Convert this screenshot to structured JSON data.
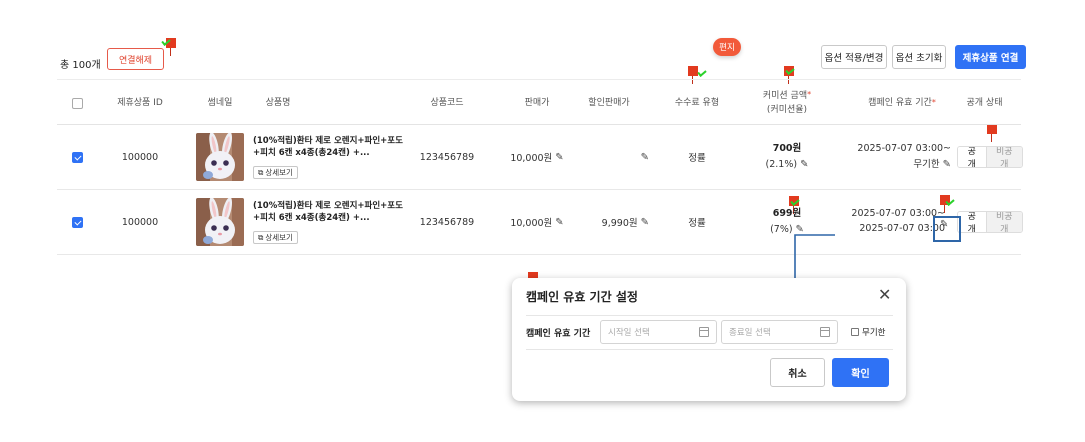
{
  "summary": {
    "total": "총 100개"
  },
  "toolbar": {
    "unlink_label": "연결해제",
    "apply_options_label": "옵션 적용/변경",
    "reset_options_label": "옵션 초기화",
    "link_products_label": "제휴상품 연결"
  },
  "hint_badge": "편지",
  "table": {
    "headers": {
      "product_id": "제휴상품 ID",
      "thumbnail": "썸네일",
      "product_name": "상품명",
      "product_code": "상품코드",
      "price": "판매가",
      "sale_price": "할인판매가",
      "fee_type": "수수료 유형",
      "commission_line1": "커미션 금액",
      "commission_line2": "(커미션율)",
      "campaign_period": "캠페인 유효 기간",
      "visibility": "공개 상태"
    },
    "rows": [
      {
        "checked": true,
        "id": "100000",
        "name": "(10%적립)환타 제로 오렌지+파인+포도+피치 6캔 x4종(총24캔) +...",
        "detail_label": "상세보기",
        "code": "123456789",
        "price": "10,000원",
        "sale_price": "",
        "fee_type": "정률",
        "commission_amount": "700원",
        "commission_rate": "(2.1%)",
        "period_line1": "2025-07-07 03:00~",
        "period_line2": "무기한",
        "visibility_on": "공개",
        "visibility_off": "비공개"
      },
      {
        "checked": true,
        "id": "100000",
        "name": "(10%적립)환타 제로 오렌지+파인+포도+피치 6캔 x4종(총24캔) +...",
        "detail_label": "상세보기",
        "code": "123456789",
        "price": "10,000원",
        "sale_price": "9,990원",
        "fee_type": "정률",
        "commission_amount": "699원",
        "commission_rate": "(7%)",
        "period_line1": "2025-07-07 03:00~",
        "period_line2": "2025-07-07 03:00",
        "visibility_on": "공개",
        "visibility_off": "비공개"
      }
    ]
  },
  "modal": {
    "title": "캠페인 유효 기간 설정",
    "field_label": "캠페인 유효 기간",
    "start_placeholder": "시작일 선택",
    "end_placeholder": "종료일 선택",
    "infinite_label": "무기한",
    "cancel_label": "취소",
    "confirm_label": "확인"
  },
  "icons": {
    "edit": "pencil-icon",
    "close": "close-icon",
    "calendar": "calendar-icon",
    "external": "external-link-icon"
  },
  "colors": {
    "primary": "#2f72f5",
    "danger": "#e0442f",
    "annotation_flag": "#e23a1f",
    "annotation_arrow": "#2e66a8"
  }
}
